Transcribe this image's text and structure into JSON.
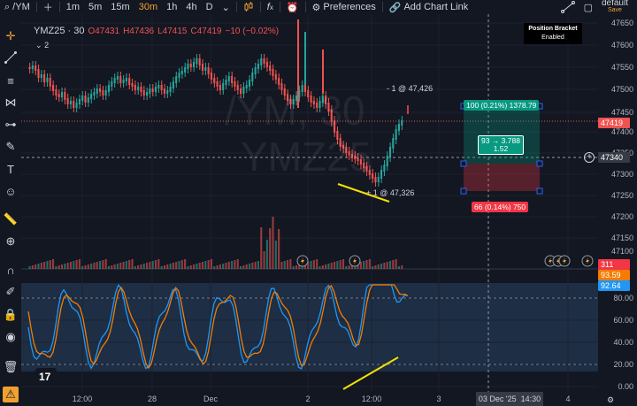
{
  "topbar": {
    "symbol": "/YM",
    "intervals": [
      "1m",
      "5m",
      "15m",
      "30m",
      "1h",
      "4h",
      "D"
    ],
    "active_interval": "30m",
    "preferences": "Preferences",
    "add_chart_link": "Add Chart Link",
    "layout_name": "default",
    "layout_status": "Save"
  },
  "popup": {
    "title": "Position Bracket",
    "status": "Enabled"
  },
  "legend": {
    "symbol": "YMZ25 · 30",
    "open": "O47431",
    "high": "H47436",
    "low": "L47415",
    "close": "C47419",
    "change": "−10 (−0.02%)",
    "sub_count": "2"
  },
  "watermark": {
    "line1": "/YM, 30",
    "line2": "YMZ25"
  },
  "annotations": {
    "fill_top": "- 1 @ 47,426",
    "fill_bottom": "+ 1 @ 47,326",
    "target": "100 (0.21%) 1378.79",
    "center_line1": "93 → 3.788",
    "center_line2": "1.52",
    "stop": "66 (0.14%) 750"
  },
  "price_axis": {
    "ticks": [
      "47650",
      "47600",
      "47550",
      "47500",
      "47450",
      "47400",
      "47350",
      "47300",
      "47250",
      "47200",
      "47150",
      "47100",
      "47050"
    ],
    "current_price": "47419",
    "crosshair_price": "47340",
    "entry_label": "311",
    "osc_k": "93.59",
    "osc_d": "92.64",
    "osc_ticks": [
      "80.00",
      "60.00",
      "40.00",
      "20.00",
      "0.00"
    ]
  },
  "time_axis": {
    "labels": [
      "12:00",
      "28",
      "Dec",
      "2",
      "12:00",
      "3",
      "4"
    ],
    "crosshair_date": "03 Dec '25",
    "crosshair_time": "14:30"
  },
  "colors": {
    "up": "#26a69a",
    "down": "#ef5350",
    "osc_k": "#2196f3",
    "osc_d": "#f57c00",
    "trendline": "#f5e100"
  }
}
